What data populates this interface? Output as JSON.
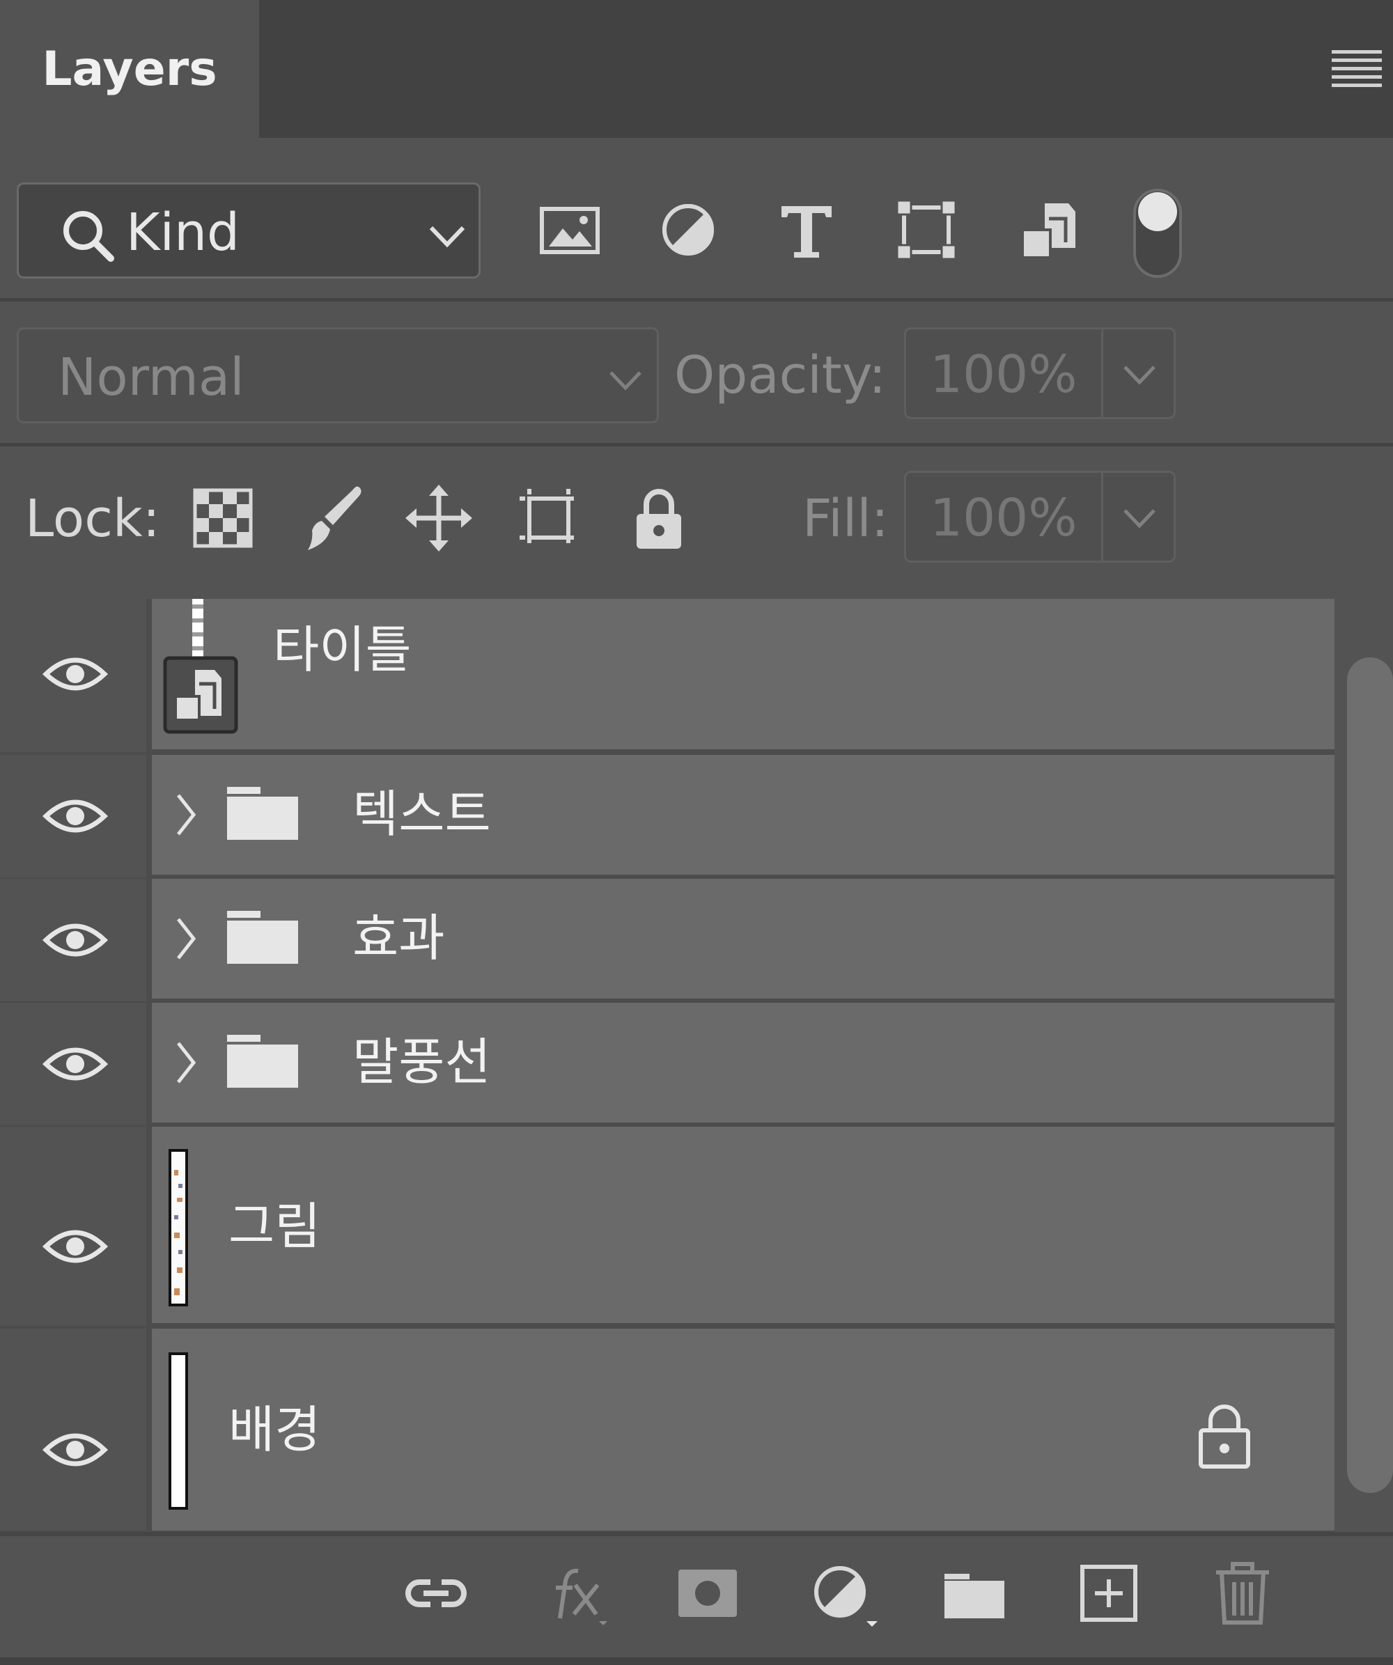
{
  "panel": {
    "tab_title": "Layers",
    "menu_icon": "panel-menu-icon"
  },
  "filter": {
    "kind_label": "Kind",
    "icons": [
      "pixel-layer-filter-icon",
      "adjustment-layer-filter-icon",
      "type-layer-filter-icon",
      "shape-layer-filter-icon",
      "smart-object-filter-icon"
    ],
    "toggle": "filter-toggle-icon"
  },
  "blend": {
    "mode": "Normal",
    "opacity_label": "Opacity:",
    "opacity_value": "100%"
  },
  "lock": {
    "label": "Lock:",
    "icons": [
      "lock-transparent-pixels-icon",
      "lock-image-pixels-icon",
      "lock-position-icon",
      "lock-artboard-icon",
      "lock-all-icon"
    ],
    "fill_label": "Fill:",
    "fill_value": "100%"
  },
  "layers": [
    {
      "name": "타이틀",
      "type": "smart-object",
      "visible": true
    },
    {
      "name": "텍스트",
      "type": "group",
      "visible": true
    },
    {
      "name": "효과",
      "type": "group",
      "visible": true
    },
    {
      "name": "말풍선",
      "type": "group",
      "visible": true
    },
    {
      "name": "그림",
      "type": "pixel",
      "visible": true
    },
    {
      "name": "배경",
      "type": "background",
      "visible": true,
      "locked": true
    }
  ],
  "footer": {
    "icons": [
      "link-layers-icon",
      "add-layer-style-icon",
      "add-mask-icon",
      "new-adjustment-layer-icon",
      "new-group-icon",
      "new-layer-icon",
      "delete-layer-icon"
    ]
  },
  "colors": {
    "panel_bg": "#535353",
    "header_bg": "#424242",
    "row_bg": "#6a6a6a"
  }
}
